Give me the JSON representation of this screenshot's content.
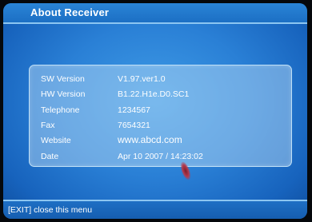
{
  "header": {
    "title": "About Receiver"
  },
  "info": {
    "rows": [
      {
        "label": "SW Version",
        "value": "V1.97.ver1.0"
      },
      {
        "label": "HW Version",
        "value": "B1.22.H1e.D0.SC1"
      },
      {
        "label": "Telephone",
        "value": "1234567"
      },
      {
        "label": "Fax",
        "value": "7654321"
      },
      {
        "label": "Website",
        "value": "www.abcd.com"
      },
      {
        "label": "Date",
        "value": "Apr 10 2007 / 14:23:02"
      }
    ]
  },
  "footer": {
    "hint": "[EXIT] close this menu"
  },
  "colors": {
    "background": "#2a80d6",
    "panel": "#bedef6",
    "text": "#ffffff"
  }
}
